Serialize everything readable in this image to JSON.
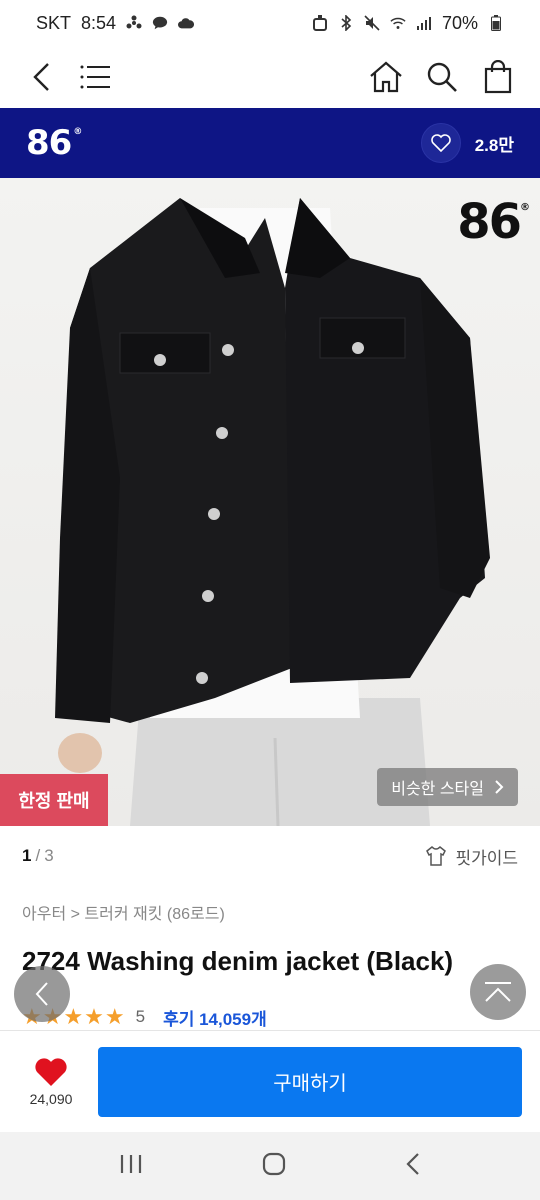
{
  "status_bar": {
    "carrier": "SKT",
    "time": "8:54",
    "battery": "70%"
  },
  "brand": {
    "logo": "86",
    "logo_mark": "®",
    "like_count": "2.8만"
  },
  "image": {
    "logo": "86",
    "logo_mark": "®",
    "badge": "한정 판매",
    "similar_style": "비슷한 스타일"
  },
  "pager": {
    "current": "1",
    "separator": "/",
    "total": "3",
    "fit_guide": "핏가이드"
  },
  "product": {
    "breadcrumb": "아우터 > 트러커 재킷 (86로드)",
    "title": "2724 Washing denim jacket (Black)",
    "stars": "★★★★★",
    "rating": "5",
    "reviews": "후기 14,059개"
  },
  "bottom": {
    "wish_count": "24,090",
    "buy_label": "구매하기"
  },
  "colors": {
    "brand_bar": "#0e1585",
    "buy_button": "#0a78f0",
    "badge": "#dc4a5d",
    "stars": "#f59f2c",
    "review_link": "#1a56d9"
  }
}
